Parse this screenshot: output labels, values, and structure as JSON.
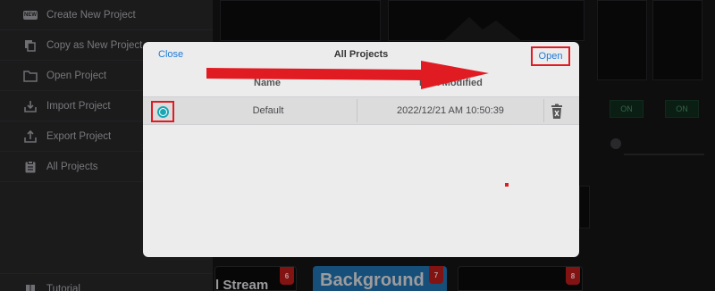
{
  "sidebar": {
    "items": [
      {
        "label": "Create New Project",
        "icon": "new-badge-icon"
      },
      {
        "label": "Copy as New Project",
        "icon": "copy-icon"
      },
      {
        "label": "Open Project",
        "icon": "folder-icon"
      },
      {
        "label": "Import Project",
        "icon": "import-icon"
      },
      {
        "label": "Export Project",
        "icon": "export-icon"
      },
      {
        "label": "All Projects",
        "icon": "clipboard-icon"
      }
    ],
    "footer_item": {
      "label": "Tutorial",
      "icon": "book-icon"
    },
    "new_badge_text": "NEW"
  },
  "background": {
    "track_buttons": [
      "ON",
      "ON"
    ],
    "scenes": [
      {
        "label": "l Stream",
        "badge": "6"
      },
      {
        "label": "Background",
        "badge": "7"
      },
      {
        "label": "",
        "badge": "8"
      }
    ],
    "scene_accent": "#1f6ea8"
  },
  "modal": {
    "close_label": "Close",
    "title": "All Projects",
    "open_label": "Open",
    "columns": {
      "name": "Name",
      "last_modified": "Last Modified"
    },
    "rows": [
      {
        "name": "Default",
        "last_modified": "2022/12/21 AM 10:50:39",
        "selected": true
      }
    ]
  },
  "colors": {
    "link": "#1e7ad6",
    "annotation": "#e11b22",
    "radio": "#1aa7b5"
  }
}
